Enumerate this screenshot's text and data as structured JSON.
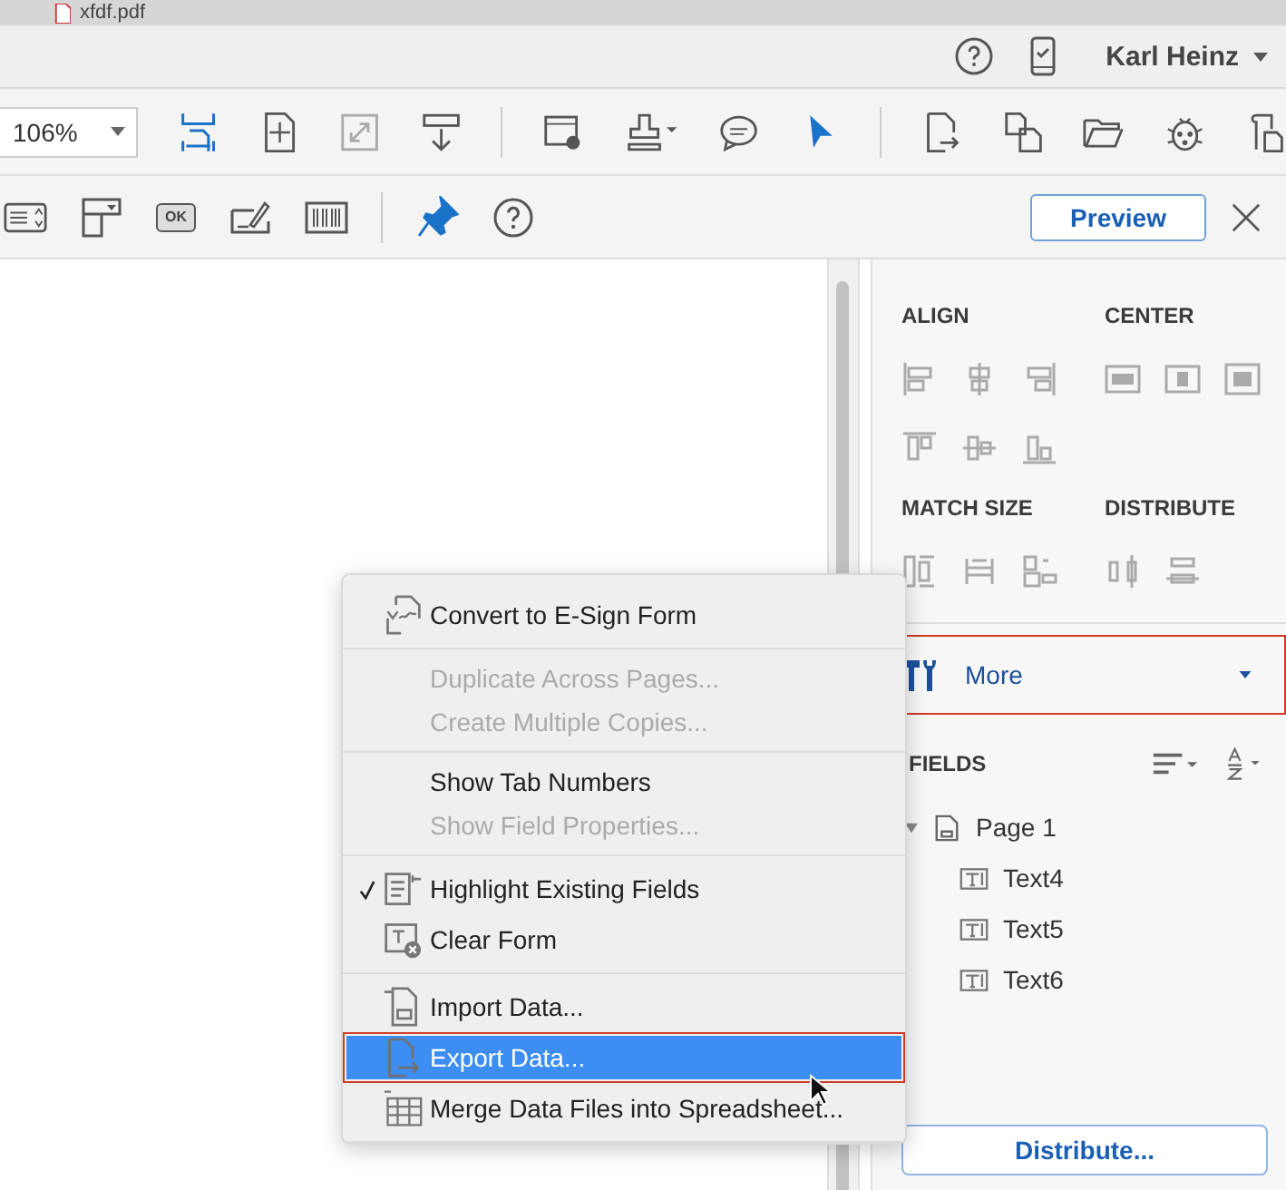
{
  "document_tab": {
    "title": "xfdf.pdf"
  },
  "header": {
    "user_name": "Karl Heinz"
  },
  "toolbar": {
    "zoom": "106%"
  },
  "form_toolbar": {
    "ok_tool": "OK",
    "preview_button": "Preview"
  },
  "panel": {
    "align_heading": "ALIGN",
    "center_heading": "CENTER",
    "match_size_heading": "MATCH SIZE",
    "distribute_heading": "DISTRIBUTE",
    "more": {
      "label": "More",
      "outlined": true
    },
    "fields_heading": "FIELDS",
    "tree": [
      {
        "label": "Page 1",
        "kind": "page",
        "expanded": true,
        "children": [
          {
            "label": "Text4",
            "kind": "text"
          },
          {
            "label": "Text5",
            "kind": "text"
          },
          {
            "label": "Text6",
            "kind": "text"
          }
        ]
      }
    ],
    "distribute_button": "Distribute..."
  },
  "menu": {
    "groups": [
      [
        {
          "label": "Convert to E-Sign Form",
          "kind": "esign",
          "disabled": false,
          "checked": false,
          "selected": false
        }
      ],
      [
        {
          "label": "Duplicate Across Pages...",
          "kind": "plain",
          "disabled": true,
          "checked": false,
          "selected": false
        },
        {
          "label": "Create Multiple Copies...",
          "kind": "plain",
          "disabled": true,
          "checked": false,
          "selected": false
        }
      ],
      [
        {
          "label": "Show Tab Numbers",
          "kind": "plain",
          "disabled": false,
          "checked": false,
          "selected": false
        },
        {
          "label": "Show Field Properties...",
          "kind": "plain",
          "disabled": true,
          "checked": false,
          "selected": false
        }
      ],
      [
        {
          "label": "Highlight Existing Fields",
          "kind": "highlight",
          "disabled": false,
          "checked": true,
          "selected": false
        },
        {
          "label": "Clear Form",
          "kind": "clear",
          "disabled": false,
          "checked": false,
          "selected": false
        }
      ],
      [
        {
          "label": "Import Data...",
          "kind": "import",
          "disabled": false,
          "checked": false,
          "selected": false
        },
        {
          "label": "Export Data...",
          "kind": "export",
          "disabled": false,
          "checked": false,
          "selected": true,
          "outlined": true
        },
        {
          "label": "Merge Data Files into Spreadsheet...",
          "kind": "table",
          "disabled": false,
          "checked": false,
          "selected": false
        }
      ]
    ]
  }
}
